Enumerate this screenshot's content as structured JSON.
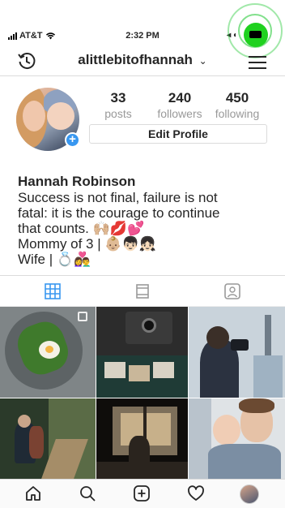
{
  "status": {
    "carrier": "AT&T",
    "time": "2:32 PM",
    "right_glyphs": "◂ ◐"
  },
  "header": {
    "history_icon": "history-clock-icon",
    "username": "alittlebitofhannah",
    "menu_icon": "hamburger-menu-icon"
  },
  "profile": {
    "stats": [
      {
        "value": "33",
        "label": "posts"
      },
      {
        "value": "240",
        "label": "followers"
      },
      {
        "value": "450",
        "label": "following"
      }
    ],
    "edit_label": "Edit Profile",
    "add_badge": "+"
  },
  "bio": {
    "name": "Hannah Robinson",
    "lines": [
      "Success is not final, failure is not",
      "fatal: it is the courage to continue",
      "that counts. 🙌🏼💋💕",
      "Mommy of 3 | 👶🏼👦🏻👧🏻",
      "Wife | 💍👩‍❤️‍👨"
    ]
  },
  "tabs": [
    {
      "name": "grid-icon",
      "active": true
    },
    {
      "name": "feed-icon",
      "active": false
    },
    {
      "name": "tagged-icon",
      "active": false
    }
  ],
  "posts": [
    {
      "subject": "avocado toast with poached egg",
      "colors": [
        "#7f8587",
        "#5d6365",
        "#3f7a2c",
        "#f4f1e6"
      ]
    },
    {
      "subject": "instant camera with photos",
      "colors": [
        "#1f3b36",
        "#2c2c2c",
        "#c9b79a",
        "#d8d2c4"
      ]
    },
    {
      "subject": "man with binoculars and skyline",
      "colors": [
        "#c9d3db",
        "#2b3240",
        "#9fb2c2",
        "#6f7c88"
      ]
    },
    {
      "subject": "hikers on forest trail",
      "colors": [
        "#2b3a2a",
        "#5a6b46",
        "#a58d68",
        "#1f2a35"
      ]
    },
    {
      "subject": "silhouette at window",
      "colors": [
        "#2a241e",
        "#7d6f5a",
        "#c7b08a",
        "#0f0d0b"
      ]
    },
    {
      "subject": "father and baby",
      "colors": [
        "#dfe3e6",
        "#b9c3cc",
        "#e6c2a7",
        "#7b8ea3"
      ]
    }
  ],
  "bottom_nav": [
    "home-icon",
    "search-icon",
    "new-post-icon",
    "activity-heart-icon",
    "profile-avatar-icon"
  ],
  "colors": {
    "accent": "#3897f0",
    "text": "#262626",
    "muted": "#999999",
    "border": "#dbdbdb",
    "touch": "#1fd11f"
  }
}
